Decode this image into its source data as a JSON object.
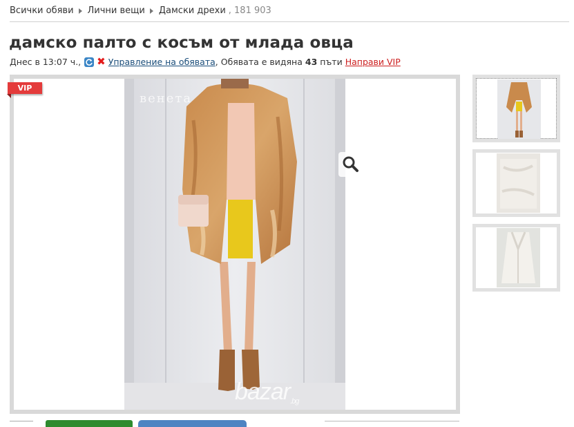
{
  "breadcrumb": {
    "items": [
      "Всички обяви",
      "Лични вещи",
      "Дамски дрехи"
    ],
    "count": ", 181 903"
  },
  "listing": {
    "title": "дамско палто с косъм от млада овца",
    "posted": "Днес в 13:07 ч.,",
    "manage_link": "Управление на обявата",
    "views_prefix": ", Обявата е видяна",
    "views_count": "43",
    "views_suffix": "пъти",
    "vip_link": "Направи VIP"
  },
  "gallery": {
    "vip_badge": "VIP",
    "watermark_top": "венета",
    "watermark_brand": "bazar",
    "watermark_tld": ".bg",
    "zoom_icon": "magnifier-icon",
    "thumbnails": [
      "coat-front-thumbnail",
      "white-fur-thumbnail",
      "white-coat-thumbnail"
    ]
  },
  "colors": {
    "link": "#1a4d7a",
    "vip": "#cc1d1d",
    "badge": "#e43b3b",
    "green_button": "#2e8b2e",
    "blue_button": "#4e84c2"
  }
}
